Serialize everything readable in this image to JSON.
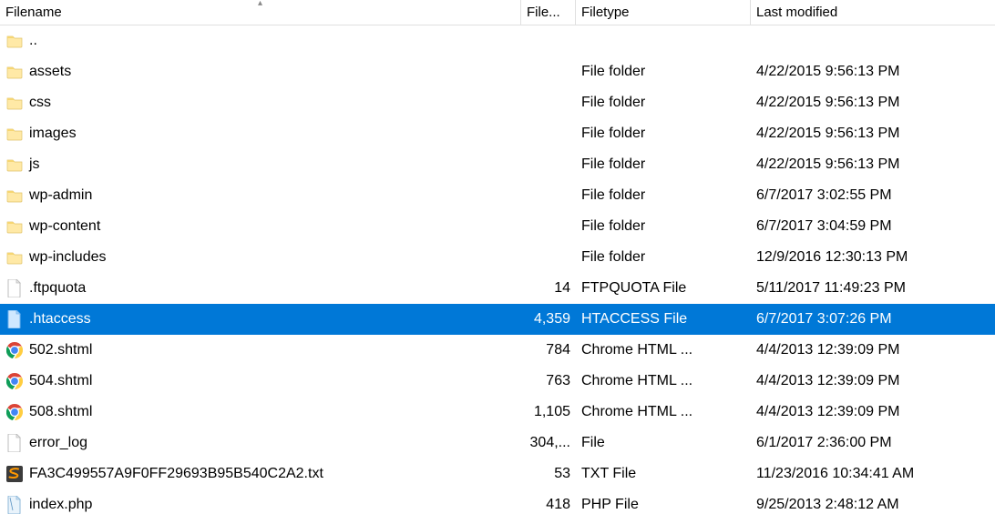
{
  "columns": {
    "name": "Filename",
    "size": "File...",
    "type": "Filetype",
    "date": "Last modified"
  },
  "sort": {
    "column": "name",
    "direction": "asc"
  },
  "rows": [
    {
      "icon": "folder",
      "name": "..",
      "size": "",
      "type": "",
      "date": "",
      "selected": false
    },
    {
      "icon": "folder",
      "name": "assets",
      "size": "",
      "type": "File folder",
      "date": "4/22/2015 9:56:13 PM",
      "selected": false
    },
    {
      "icon": "folder",
      "name": "css",
      "size": "",
      "type": "File folder",
      "date": "4/22/2015 9:56:13 PM",
      "selected": false
    },
    {
      "icon": "folder",
      "name": "images",
      "size": "",
      "type": "File folder",
      "date": "4/22/2015 9:56:13 PM",
      "selected": false
    },
    {
      "icon": "folder",
      "name": "js",
      "size": "",
      "type": "File folder",
      "date": "4/22/2015 9:56:13 PM",
      "selected": false
    },
    {
      "icon": "folder",
      "name": "wp-admin",
      "size": "",
      "type": "File folder",
      "date": "6/7/2017 3:02:55 PM",
      "selected": false
    },
    {
      "icon": "folder",
      "name": "wp-content",
      "size": "",
      "type": "File folder",
      "date": "6/7/2017 3:04:59 PM",
      "selected": false
    },
    {
      "icon": "folder",
      "name": "wp-includes",
      "size": "",
      "type": "File folder",
      "date": "12/9/2016 12:30:13 PM",
      "selected": false
    },
    {
      "icon": "file",
      "name": ".ftpquota",
      "size": "14",
      "type": "FTPQUOTA File",
      "date": "5/11/2017 11:49:23 PM",
      "selected": false
    },
    {
      "icon": "bluefile",
      "name": ".htaccess",
      "size": "4,359",
      "type": "HTACCESS File",
      "date": "6/7/2017 3:07:26 PM",
      "selected": true
    },
    {
      "icon": "chrome",
      "name": "502.shtml",
      "size": "784",
      "type": "Chrome HTML ...",
      "date": "4/4/2013 12:39:09 PM",
      "selected": false
    },
    {
      "icon": "chrome",
      "name": "504.shtml",
      "size": "763",
      "type": "Chrome HTML ...",
      "date": "4/4/2013 12:39:09 PM",
      "selected": false
    },
    {
      "icon": "chrome",
      "name": "508.shtml",
      "size": "1,105",
      "type": "Chrome HTML ...",
      "date": "4/4/2013 12:39:09 PM",
      "selected": false
    },
    {
      "icon": "file",
      "name": "error_log",
      "size": "304,...",
      "type": "File",
      "date": "6/1/2017 2:36:00 PM",
      "selected": false
    },
    {
      "icon": "sublime",
      "name": "FA3C499557A9F0FF29693B95B540C2A2.txt",
      "size": "53",
      "type": "TXT File",
      "date": "11/23/2016 10:34:41 AM",
      "selected": false
    },
    {
      "icon": "php",
      "name": "index.php",
      "size": "418",
      "type": "PHP File",
      "date": "9/25/2013 2:48:12 AM",
      "selected": false
    }
  ]
}
